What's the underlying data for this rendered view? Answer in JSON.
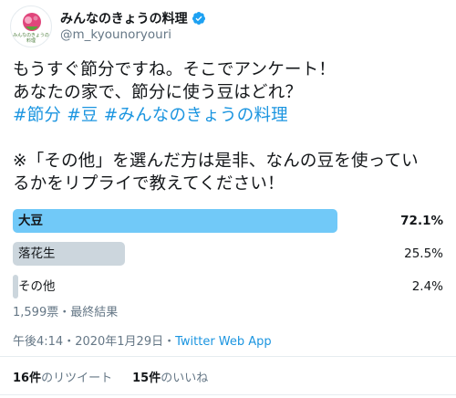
{
  "account": {
    "display_name": "みんなのきょうの料理",
    "handle": "@m_kyounoryouri",
    "avatar_text": "みんなのきょうの料理",
    "verified_icon": "verified-badge-icon",
    "brand_color": "#1da1f2"
  },
  "tweet": {
    "lines": [
      "もうすぐ節分ですね。そこでアンケート！",
      "あなたの家で、節分に使う豆はどれ？"
    ],
    "hashtags": [
      "#節分",
      "#豆",
      "#みんなのきょうの料理"
    ],
    "note_lines": [
      "※「その他」を選んだ方は是非、なんの豆を使ってい",
      "るかをリプライで教えてください！"
    ]
  },
  "poll": {
    "options": [
      {
        "label": "大豆",
        "percent": "72.1%",
        "value": 72.1,
        "bar_fill": 0.75,
        "color": "#71c9f8",
        "winner": true
      },
      {
        "label": "落花生",
        "percent": "25.5%",
        "value": 25.5,
        "bar_fill": 0.26,
        "color": "#ccd6dd",
        "winner": false
      },
      {
        "label": "その他",
        "percent": "2.4%",
        "value": 2.4,
        "bar_fill": 0.012,
        "color": "#ccd6dd",
        "winner": false
      }
    ],
    "meta": "1,599票・最終結果"
  },
  "timestamp": {
    "time": "午後4:14・2020年1月29日・",
    "app": "Twitter Web App"
  },
  "stats": {
    "retweets_count": "16件",
    "retweets_label": "のリツイート",
    "likes_count": "15件",
    "likes_label": "のいいね"
  }
}
